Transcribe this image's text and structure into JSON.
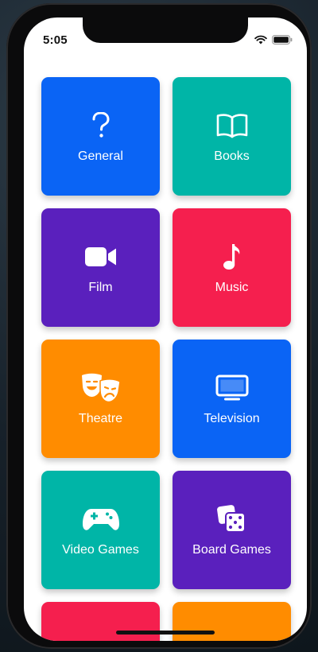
{
  "status_bar": {
    "time": "5:05",
    "icons": [
      "wifi-icon",
      "battery-icon"
    ]
  },
  "categories": [
    {
      "label": "General",
      "icon": "question-icon",
      "color": "#0a64f5"
    },
    {
      "label": "Books",
      "icon": "book-icon",
      "color": "#00b5a7"
    },
    {
      "label": "Film",
      "icon": "video-camera-icon",
      "color": "#5a20bd"
    },
    {
      "label": "Music",
      "icon": "music-note-icon",
      "color": "#f51f4e"
    },
    {
      "label": "Theatre",
      "icon": "theatre-masks-icon",
      "color": "#ff8c00"
    },
    {
      "label": "Television",
      "icon": "tv-icon",
      "color": "#0a64f5"
    },
    {
      "label": "Video Games",
      "icon": "gamepad-icon",
      "color": "#00b5a7"
    },
    {
      "label": "Board Games",
      "icon": "dice-icon",
      "color": "#5a20bd"
    }
  ],
  "partial_tiles": [
    {
      "color": "#f51f4e"
    },
    {
      "color": "#ff8c00"
    }
  ]
}
